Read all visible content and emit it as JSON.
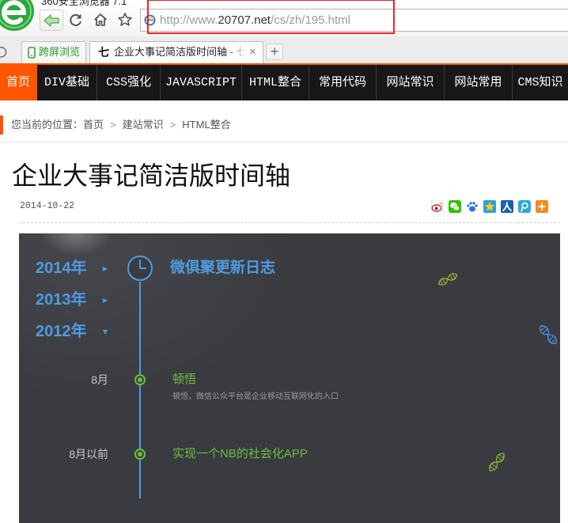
{
  "browser": {
    "app_title": "360安全浏览器 7.1",
    "url_prefix": "http://www.",
    "url_domain": "20707.net",
    "url_path": "/cs/zh/195.html",
    "toolbar_icons": [
      "back-arrow-icon",
      "refresh-icon",
      "home-icon",
      "star-icon"
    ],
    "tabs": [
      {
        "label": "跨屏浏览",
        "icon": "phone-icon"
      },
      {
        "favicon": "七",
        "label": "企业大事记简洁版时间轴 - 七七",
        "close": "×"
      }
    ],
    "new_tab": "+",
    "highlight_color": "#e8262b"
  },
  "site": {
    "accent": "#ff5500",
    "nav": [
      {
        "label": "首页",
        "active": true
      },
      {
        "label": "DIV基础"
      },
      {
        "label": "CSS强化"
      },
      {
        "label": "JAVASCRIPT"
      },
      {
        "label": "HTML整合"
      },
      {
        "label": "常用代码"
      },
      {
        "label": "网站常识"
      },
      {
        "label": "网站常用"
      },
      {
        "label": "CMS知识"
      }
    ],
    "breadcrumb": {
      "prefix": "您当前的位置：",
      "separator": ">",
      "items": [
        "首页",
        "建站常识",
        "HTML整合"
      ]
    },
    "article": {
      "title": "企业大事记简洁版时间轴",
      "date": "2014-10-22",
      "share_icons": [
        "weibo-icon",
        "wechat-icon",
        "baidu-icon",
        "qzone-icon",
        "renren-icon",
        "tencent-weibo-icon",
        "more-share-icon"
      ]
    }
  },
  "timeline": {
    "colors": {
      "blue": "#4e9be2",
      "green": "#66c03c",
      "background": "#3a3b40"
    },
    "years": [
      {
        "label": "2014年",
        "arrow": "▸"
      },
      {
        "label": "2013年",
        "arrow": "▸"
      },
      {
        "label": "2012年",
        "arrow": "▾"
      }
    ],
    "heading": "微俱聚更新日志",
    "events": [
      {
        "date": "8月",
        "title": "顿悟",
        "desc": "顿悟，微信公众平台是企业移动互联网化的入口"
      },
      {
        "date": "8月以前",
        "title": "实现一个NB的社会化APP"
      }
    ]
  }
}
